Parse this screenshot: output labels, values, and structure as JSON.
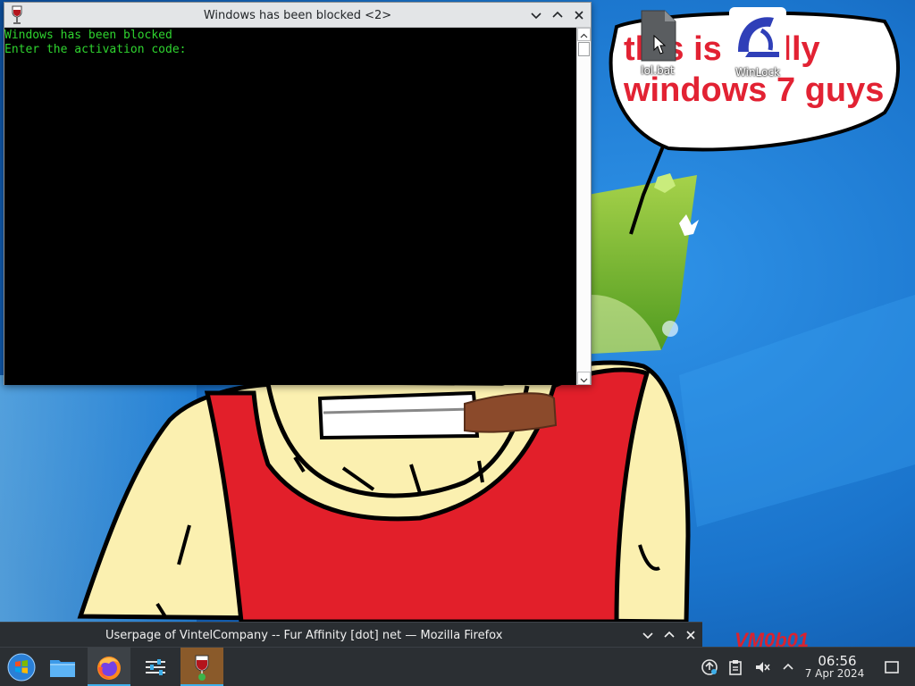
{
  "desktop": {
    "meme_text": [
      "this is really",
      "windows 7 guys"
    ],
    "watermark": "VM0b01",
    "icons": [
      {
        "label": "lol.bat",
        "icon": "batch-file-icon"
      },
      {
        "label": "WinLock",
        "icon": "winlock-icon"
      }
    ]
  },
  "console_window": {
    "title": "Windows has been blocked <2>",
    "lines": [
      "Windows has been blocked",
      "Enter the activation code:"
    ],
    "text_color": "#2fd42f",
    "background": "#000000"
  },
  "firefox_window": {
    "title": "Userpage of VintelCompany -- Fur Affinity [dot] net — Mozilla Firefox"
  },
  "taskbar": {
    "launchers": [
      "start-menu-icon",
      "file-manager-icon",
      "firefox-icon",
      "settings-icon",
      "wine-app-icon"
    ],
    "tray": [
      "update-icon",
      "clipboard-icon",
      "volume-muted-icon",
      "expand-tray-icon"
    ],
    "clock": {
      "time": "06:56",
      "date": "7 Apr 2024"
    },
    "accent": "#3daee9"
  }
}
